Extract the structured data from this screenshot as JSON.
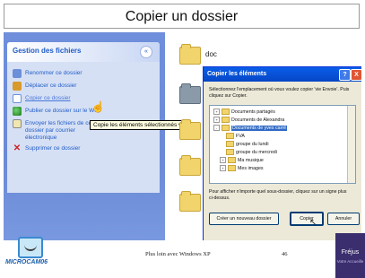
{
  "slide": {
    "title": "Copier un dossier",
    "footer_center": "Plus loin avec Windows XP",
    "page_number": "46",
    "logo_text": "MICROCAM06",
    "partner_name": "Fréjus",
    "partner_tagline": "Votre Accueille"
  },
  "task_pane": {
    "header": "Gestion des fichiers",
    "collapse_symbol": "«",
    "items": [
      {
        "label": "Renommer ce dossier",
        "icon": "rename-icon"
      },
      {
        "label": "Déplacer ce dossier",
        "icon": "move-icon"
      },
      {
        "label": "Copier ce dossier",
        "icon": "copy-icon"
      },
      {
        "label": "Publier ce dossier sur le Web",
        "icon": "web-icon"
      },
      {
        "label": "Envoyer les fichiers de ce dossier par courrier électronique",
        "icon": "mail-icon"
      },
      {
        "label": "Supprimer ce dossier",
        "icon": "delete-icon"
      }
    ],
    "tooltip": "Copie les éléments sélectionnés ve"
  },
  "file_area": {
    "folder_label": "doc"
  },
  "dialog": {
    "title": "Copier les éléments",
    "intro": "Sélectionnez l'emplacement où vous voulez copier 'vie Envoie'. Puis cliquez sur Copier.",
    "tree": [
      {
        "label": "Documents partagés",
        "indent": 1,
        "expander": "+"
      },
      {
        "label": "Documents de Alexandra",
        "indent": 1,
        "expander": "+"
      },
      {
        "label": "Documents de yves carré",
        "indent": 1,
        "expander": "-",
        "selected": true
      },
      {
        "label": "FVA",
        "indent": 2,
        "expander": ""
      },
      {
        "label": "groupe du lundi",
        "indent": 2,
        "expander": ""
      },
      {
        "label": "groupe du mercredi",
        "indent": 2,
        "expander": ""
      },
      {
        "label": "Ma musique",
        "indent": 2,
        "expander": "+"
      },
      {
        "label": "Mes images",
        "indent": 2,
        "expander": "+"
      }
    ],
    "footnote": "Pour afficher n'importe quel sous-dossier, cliquez sur un signe plus ci-dessus.",
    "buttons": {
      "new_folder": "Créer un nouveau dossier",
      "copy": "Copier",
      "cancel": "Annuler"
    },
    "help_symbol": "?",
    "close_symbol": "X"
  },
  "colors": {
    "pane_blue": "#6f8fdc",
    "link_blue": "#215dc6",
    "dialog_title_blue": "#0a5ee8",
    "selection_blue": "#316ac5"
  }
}
